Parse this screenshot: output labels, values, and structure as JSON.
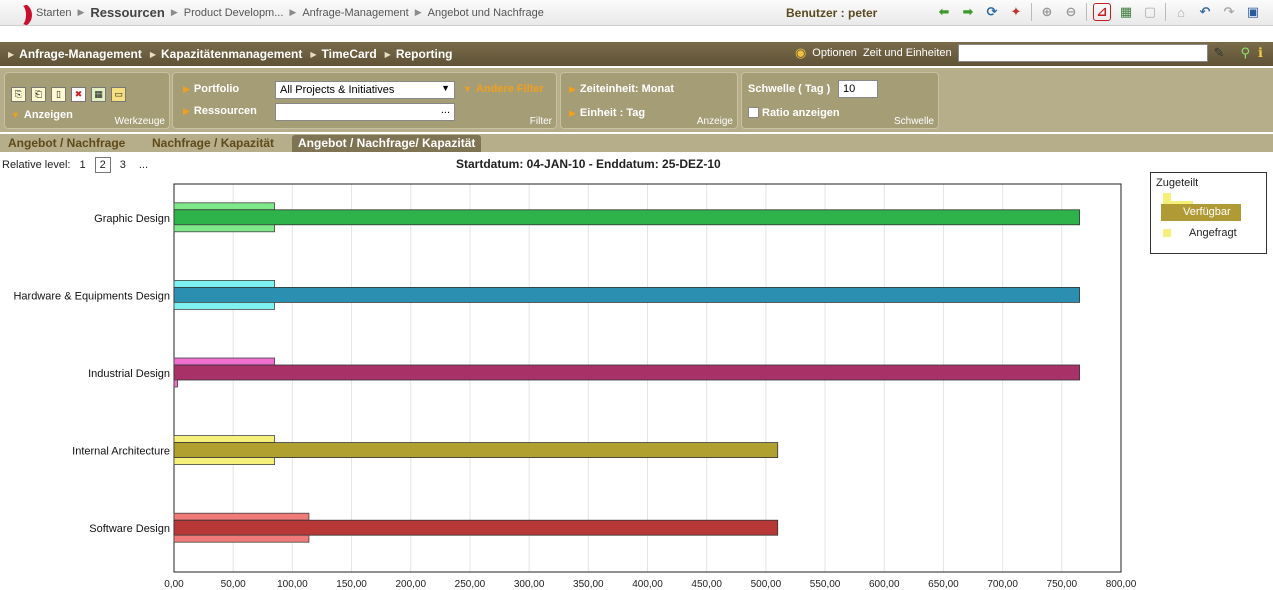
{
  "topbar": {
    "crumbs": [
      "Starten",
      "Ressourcen",
      "Product Developm...",
      "Anfrage-Management",
      "Angebot und Nachfrage"
    ],
    "user": "Benutzer : peter"
  },
  "nav": {
    "items": [
      "Anfrage-Management",
      "Kapazitätenmanagement",
      "TimeCard",
      "Reporting"
    ],
    "options": "Optionen",
    "units": "Zeit und Einheiten",
    "search_value": ""
  },
  "toolbar": {
    "anzeigen": "Anzeigen",
    "werkzeuge": "Werkzeuge",
    "portfolio": "Portfolio",
    "portfolio_value": "All Projects & Initiatives",
    "ressourcen": "Ressourcen",
    "ressourcen_value": "...",
    "andere_filter": "Andere Filter",
    "filter": "Filter",
    "zeiteinheit": "Zeiteinheit: Monat",
    "einheit": "Einheit : Tag",
    "anzeige": "Anzeige",
    "schwelle_label": "Schwelle ( Tag )",
    "schwelle_value": "10",
    "ratio": "Ratio anzeigen",
    "schwelle": "Schwelle"
  },
  "tabs": [
    "Angebot / Nachfrage",
    "Nachfrage / Kapazität",
    "Angebot / Nachfrage/ Kapazität"
  ],
  "relative": {
    "label": "Relative level:",
    "levels": [
      "1",
      "2",
      "3",
      "..."
    ]
  },
  "dates": "Startdatum: 04-JAN-10 - Enddatum: 25-DEZ-10",
  "colors": {
    "graphic_top": "#7ee88a",
    "graphic_mid": "#2db34a",
    "hardware_top": "#7df0f0",
    "hardware_mid": "#2a8fb0",
    "industrial_top": "#f06ed0",
    "industrial_mid": "#a83268",
    "internal_top": "#f5f07a",
    "internal_mid": "#b0a030",
    "software_top": "#f07a78",
    "software_mid": "#b83838"
  },
  "legend": {
    "zugeteilt": "Zugeteilt",
    "verfuegbar": "Verfügbar",
    "angefragt": "Angefragt"
  },
  "chart_data": {
    "type": "bar",
    "orientation": "horizontal",
    "categories": [
      "Graphic Design",
      "Hardware & Equipments Design",
      "Industrial Design",
      "Internal Architecture",
      "Software Design"
    ],
    "series": [
      {
        "name": "Zugeteilt",
        "values": [
          85,
          85,
          85,
          85,
          114
        ]
      },
      {
        "name": "Verfügbar",
        "values": [
          765,
          765,
          765,
          510,
          510
        ]
      },
      {
        "name": "Angefragt",
        "values": [
          85,
          85,
          3,
          85,
          114
        ]
      }
    ],
    "xlim": [
      0,
      800
    ],
    "xticks": [
      "0,00",
      "50,00",
      "100,00",
      "150,00",
      "200,00",
      "250,00",
      "300,00",
      "350,00",
      "400,00",
      "450,00",
      "500,00",
      "550,00",
      "600,00",
      "650,00",
      "700,00",
      "750,00",
      "800,00"
    ],
    "grid": true,
    "legend_position": "top-right"
  }
}
